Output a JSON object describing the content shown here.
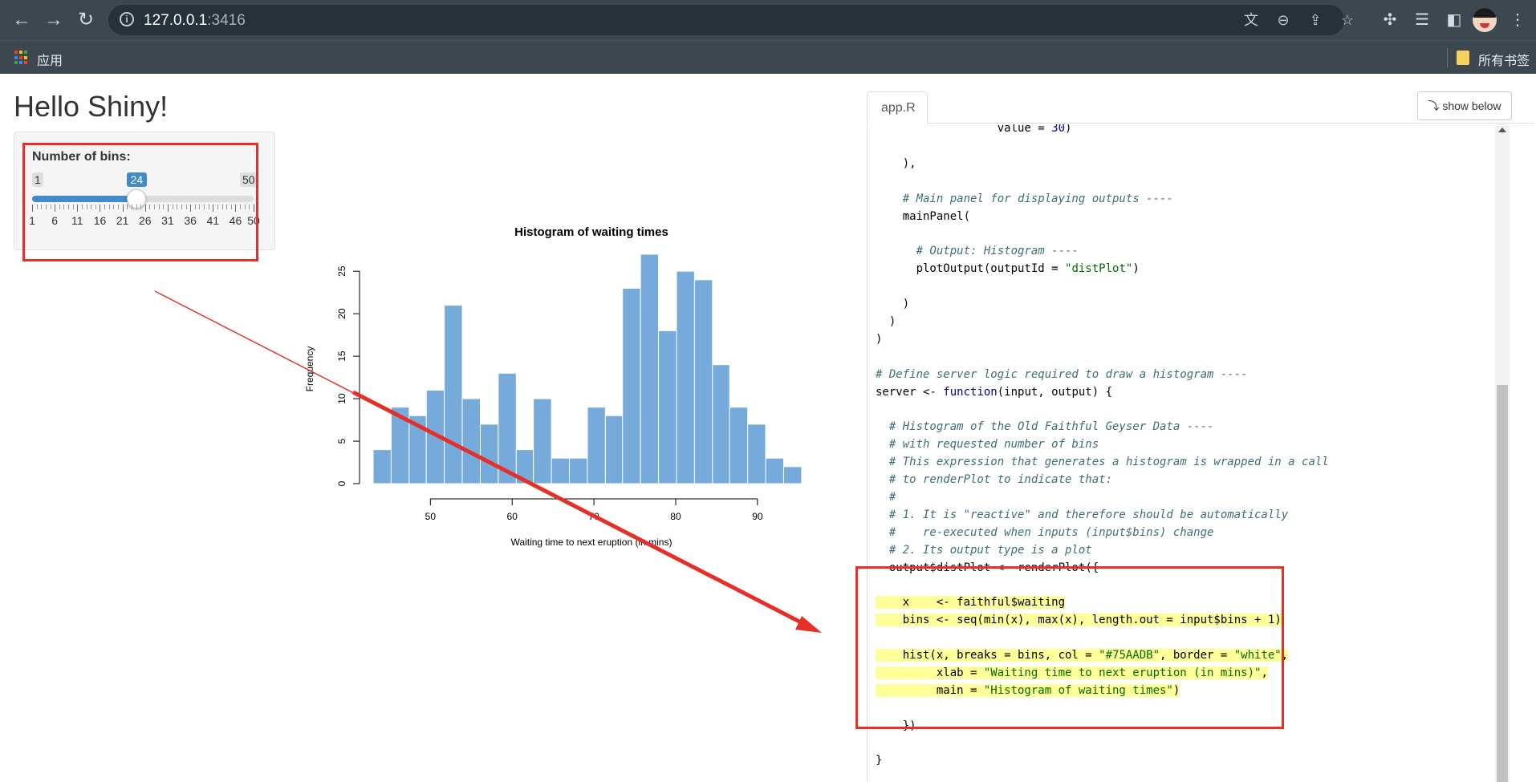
{
  "browser": {
    "url_host": "127.0.0.1",
    "url_port": ":3416",
    "bookmark_apps": "应用",
    "bookmark_all": "所有书签",
    "apps_grid_colors": [
      "#ea4335",
      "#fbbc05",
      "#34a853",
      "#4285f4",
      "#ea4335",
      "#fbbc05",
      "#34a853",
      "#4285f4",
      "#ea4335"
    ]
  },
  "app": {
    "title": "Hello Shiny!",
    "slider": {
      "label": "Number of bins:",
      "min_label": "1",
      "max_label": "50",
      "value_label": "24",
      "value": 24,
      "min": 1,
      "max": 50,
      "tick_labels": [
        "1",
        "6",
        "11",
        "16",
        "21",
        "26",
        "31",
        "36",
        "41",
        "46",
        "50"
      ],
      "accent": "#428bca"
    }
  },
  "chart_data": {
    "type": "bar",
    "title": "Histogram of waiting times",
    "xlabel": "Waiting time to next eruption (in mins)",
    "ylabel": "Frequency",
    "bar_color": "#75AADB",
    "bar_border": "white",
    "bin_edges": [
      43,
      45.2,
      47.4,
      49.5,
      51.7,
      53.9,
      56.1,
      58.3,
      60.5,
      62.6,
      64.8,
      67,
      69.2,
      71.4,
      73.5,
      75.7,
      77.9,
      80.1,
      82.3,
      84.5,
      86.6,
      88.8,
      91,
      93.2,
      95.4
    ],
    "values": [
      4,
      9,
      8,
      11,
      21,
      10,
      7,
      13,
      4,
      10,
      3,
      3,
      9,
      8,
      23,
      27,
      18,
      25,
      24,
      14,
      9,
      7,
      3,
      2
    ],
    "xlim": [
      43,
      96
    ],
    "ylim": [
      0,
      27
    ],
    "x_ticks": [
      50,
      60,
      70,
      80,
      90
    ],
    "y_ticks": [
      0,
      5,
      10,
      15,
      20,
      25
    ]
  },
  "code_panel": {
    "tab_label": "app.R",
    "show_below_label": "⤵ show below",
    "lines": [
      {
        "segments": [
          {
            "t": "                  value = ",
            "c": ""
          },
          {
            "t": "30",
            "c": "num"
          },
          {
            "t": ")",
            "c": ""
          }
        ],
        "hl": false
      },
      {
        "segments": [
          {
            "t": "",
            "c": ""
          }
        ],
        "hl": false
      },
      {
        "segments": [
          {
            "t": "    ),",
            "c": ""
          }
        ],
        "hl": false
      },
      {
        "segments": [
          {
            "t": "",
            "c": ""
          }
        ],
        "hl": false
      },
      {
        "segments": [
          {
            "t": "    # Main panel for displaying outputs ----",
            "c": "cm"
          }
        ],
        "hl": false
      },
      {
        "segments": [
          {
            "t": "    mainPanel(",
            "c": ""
          }
        ],
        "hl": false
      },
      {
        "segments": [
          {
            "t": "",
            "c": ""
          }
        ],
        "hl": false
      },
      {
        "segments": [
          {
            "t": "      # Output: Histogram ----",
            "c": "cm"
          }
        ],
        "hl": false
      },
      {
        "segments": [
          {
            "t": "      plotOutput(outputId = ",
            "c": ""
          },
          {
            "t": "\"distPlot\"",
            "c": "str"
          },
          {
            "t": ")",
            "c": ""
          }
        ],
        "hl": false
      },
      {
        "segments": [
          {
            "t": "",
            "c": ""
          }
        ],
        "hl": false
      },
      {
        "segments": [
          {
            "t": "    )",
            "c": ""
          }
        ],
        "hl": false
      },
      {
        "segments": [
          {
            "t": "  )",
            "c": ""
          }
        ],
        "hl": false
      },
      {
        "segments": [
          {
            "t": ")",
            "c": ""
          }
        ],
        "hl": false
      },
      {
        "segments": [
          {
            "t": "",
            "c": ""
          }
        ],
        "hl": false
      },
      {
        "segments": [
          {
            "t": "# Define server logic required to draw a histogram ----",
            "c": "cm"
          }
        ],
        "hl": false
      },
      {
        "segments": [
          {
            "t": "server <- ",
            "c": ""
          },
          {
            "t": "function",
            "c": "kw"
          },
          {
            "t": "(input, output) {",
            "c": ""
          }
        ],
        "hl": false
      },
      {
        "segments": [
          {
            "t": "",
            "c": ""
          }
        ],
        "hl": false
      },
      {
        "segments": [
          {
            "t": "  # Histogram of the Old Faithful Geyser Data ----",
            "c": "cm"
          }
        ],
        "hl": false
      },
      {
        "segments": [
          {
            "t": "  # with requested number of bins",
            "c": "cm"
          }
        ],
        "hl": false
      },
      {
        "segments": [
          {
            "t": "  # This expression that generates a histogram is wrapped in a call",
            "c": "cm"
          }
        ],
        "hl": false
      },
      {
        "segments": [
          {
            "t": "  # to renderPlot to indicate that:",
            "c": "cm"
          }
        ],
        "hl": false
      },
      {
        "segments": [
          {
            "t": "  #",
            "c": "cm"
          }
        ],
        "hl": false
      },
      {
        "segments": [
          {
            "t": "  # 1. It is \"reactive\" and therefore should be automatically",
            "c": "cm"
          }
        ],
        "hl": false
      },
      {
        "segments": [
          {
            "t": "  #    re-executed when inputs (input$bins) change",
            "c": "cm"
          }
        ],
        "hl": false
      },
      {
        "segments": [
          {
            "t": "  # 2. Its output type is a plot",
            "c": "cm"
          }
        ],
        "hl": false
      },
      {
        "segments": [
          {
            "t": "  output$distPlot <- renderPlot({",
            "c": ""
          }
        ],
        "hl": false
      },
      {
        "segments": [
          {
            "t": "",
            "c": ""
          }
        ],
        "hl": false
      },
      {
        "segments": [
          {
            "t": "    x    <- faithful$waiting",
            "c": ""
          }
        ],
        "hl": true
      },
      {
        "segments": [
          {
            "t": "    bins <- seq(min(x), max(x), length.out = input$bins + ",
            "c": ""
          },
          {
            "t": "1",
            "c": "num"
          },
          {
            "t": ")",
            "c": ""
          }
        ],
        "hl": true
      },
      {
        "segments": [
          {
            "t": "",
            "c": ""
          }
        ],
        "hl": false
      },
      {
        "segments": [
          {
            "t": "    hist(x, breaks = bins, col = ",
            "c": ""
          },
          {
            "t": "\"#75AADB\"",
            "c": "str"
          },
          {
            "t": ", border = ",
            "c": ""
          },
          {
            "t": "\"white\"",
            "c": "str"
          },
          {
            "t": ",",
            "c": ""
          }
        ],
        "hl": true
      },
      {
        "segments": [
          {
            "t": "         xlab = ",
            "c": ""
          },
          {
            "t": "\"Waiting time to next eruption (in mins)\"",
            "c": "str"
          },
          {
            "t": ",",
            "c": ""
          }
        ],
        "hl": true
      },
      {
        "segments": [
          {
            "t": "         main = ",
            "c": ""
          },
          {
            "t": "\"Histogram of waiting times\"",
            "c": "str"
          },
          {
            "t": ")",
            "c": ""
          }
        ],
        "hl": true
      },
      {
        "segments": [
          {
            "t": "",
            "c": ""
          }
        ],
        "hl": false
      },
      {
        "segments": [
          {
            "t": "    })",
            "c": ""
          }
        ],
        "hl": false
      },
      {
        "segments": [
          {
            "t": "",
            "c": ""
          }
        ],
        "hl": false
      },
      {
        "segments": [
          {
            "t": "}",
            "c": ""
          }
        ],
        "hl": false
      }
    ]
  },
  "annotation": {
    "color": "#e53029"
  }
}
